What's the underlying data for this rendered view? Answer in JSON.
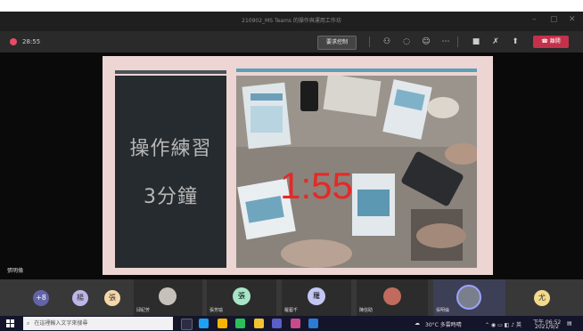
{
  "window": {
    "title": "210902_MS Teams 的操作與運用工作坊"
  },
  "toolbar": {
    "timer": "28:55",
    "request_control_label": "要求控制",
    "leave_label": "離開"
  },
  "slide": {
    "text_line1": "操作練習",
    "text_line2": "3分鐘",
    "countdown": "1:55"
  },
  "presenter": {
    "name": "張明倫"
  },
  "participants": {
    "overflow": "+8",
    "bubbles": [
      "楊",
      "張"
    ],
    "tiles": [
      {
        "name": "邱紀芳",
        "avatar": ""
      },
      {
        "name": "張芳瑜",
        "avatar": "張"
      },
      {
        "name": "羅藝千",
        "avatar": "羅"
      },
      {
        "name": "陳信助",
        "avatar": ""
      },
      {
        "name": "張明倫",
        "avatar": ""
      }
    ],
    "last_bubble": "尤"
  },
  "taskbar": {
    "search_placeholder": "在這裡輸入文字來搜尋",
    "weather": "30°C 多雲時晴",
    "time": "下午 06:52",
    "date": "2021/9/2"
  },
  "colors": {
    "leave": "#c4314b",
    "countdown": "#e62828",
    "record": "#e64c65"
  }
}
